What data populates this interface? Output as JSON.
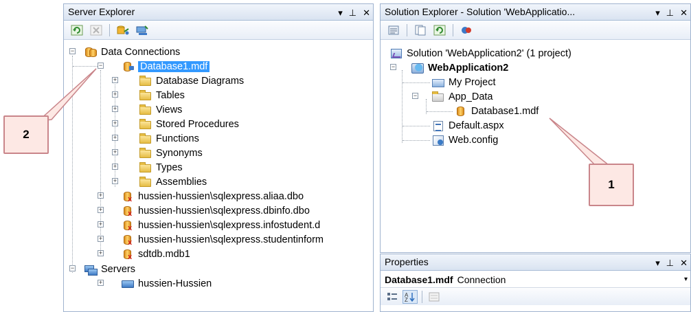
{
  "server_explorer": {
    "title": "Server Explorer",
    "controls": {
      "dropdown": "▾",
      "pin": "ꟷ",
      "close": "✕"
    },
    "toolbar": [
      "refresh-icon",
      "stop-refresh-icon",
      "connect-to-database-icon",
      "connect-to-server-icon"
    ],
    "tree": {
      "data_connections": "Data Connections",
      "database1": "Database1.mdf",
      "db_children": [
        "Database Diagrams",
        "Tables",
        "Views",
        "Stored Procedures",
        "Functions",
        "Synonyms",
        "Types",
        "Assemblies"
      ],
      "connections": [
        "hussien-hussien\\sqlexpress.aliaa.dbo",
        "hussien-hussien\\sqlexpress.dbinfo.dbo",
        "hussien-hussien\\sqlexpress.infostudent.d",
        "hussien-hussien\\sqlexpress.studentinform",
        "sdtdb.mdb1"
      ],
      "servers": "Servers",
      "server_node": "hussien-Hussien"
    }
  },
  "solution_explorer": {
    "title": "Solution Explorer - Solution 'WebApplicatio...",
    "toolbar": [
      "properties-icon",
      "show-all-files-icon",
      "refresh-icon",
      "view-class-diagram-icon"
    ],
    "tree": {
      "solution": "Solution 'WebApplication2' (1 project)",
      "project": "WebApplication2",
      "my_project": "My Project",
      "app_data": "App_Data",
      "database": "Database1.mdf",
      "default_aspx": "Default.aspx",
      "web_config": "Web.config"
    }
  },
  "properties": {
    "title": "Properties",
    "selected_object": "Database1.mdf",
    "selected_type": "Connection",
    "toolbar": [
      "categorized-icon",
      "alphabetical-icon",
      "property-pages-icon"
    ]
  },
  "callouts": {
    "one": "1",
    "two": "2"
  },
  "colors": {
    "selection": "#3399ff",
    "callout_fill": "#fde8e4",
    "callout_border": "#c9858a",
    "pane_border": "#9fb3cf"
  }
}
